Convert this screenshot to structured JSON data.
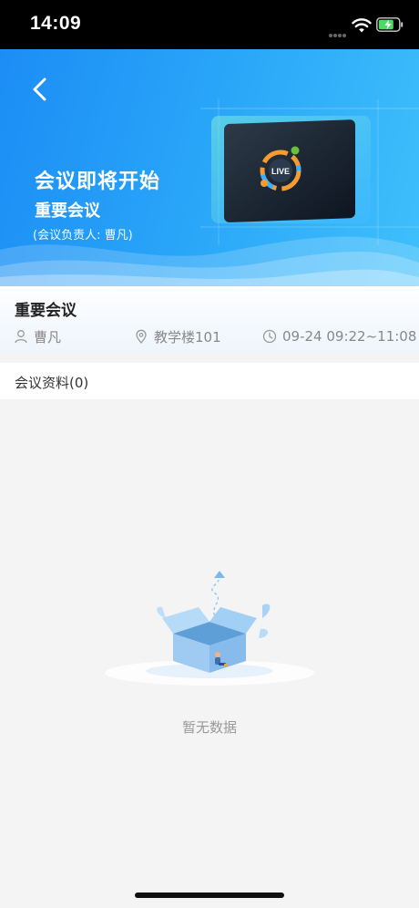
{
  "status_bar": {
    "time": "14:09"
  },
  "hero": {
    "title": "会议即将开始",
    "subtitle": "重要会议",
    "host_line": "(会议负责人: 曹凡)",
    "screen_badge": "LIVE"
  },
  "meeting": {
    "name": "重要会议",
    "host": "曹凡",
    "location": "教学楼101",
    "time": "09-24 09:22~11:08"
  },
  "materials": {
    "label": "会议资料(0)"
  },
  "empty_state": {
    "text": "暂无数据"
  },
  "colors": {
    "primary": "#1c8df5",
    "hero_light": "#3fc0fb",
    "muted_text": "#999999"
  }
}
